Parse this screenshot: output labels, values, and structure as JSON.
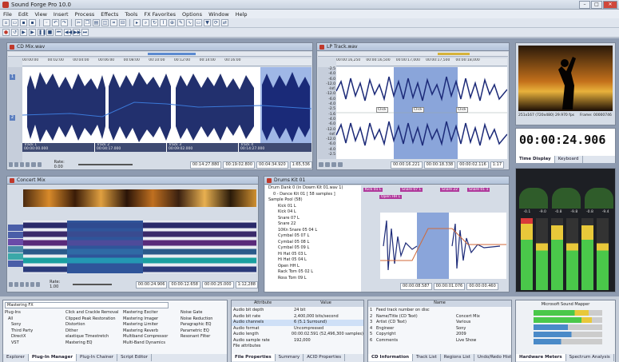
{
  "app": {
    "title": "Sound Forge Pro 10.0"
  },
  "menu": [
    "File",
    "Edit",
    "View",
    "Insert",
    "Process",
    "Effects",
    "Tools",
    "FX Favorites",
    "Options",
    "Window",
    "Help"
  ],
  "windows": {
    "cd_mix": {
      "title": "CD Mix.wav",
      "rate": "Rate: 0.00",
      "time1": "00:14:27.880",
      "time2": "00:19:02.800",
      "time3": "00:04:34.920",
      "zoom": "1:65,536",
      "tracks": [
        "Track 1",
        "Track 2",
        "Track 3",
        "Track 4"
      ],
      "track_times": [
        "00:00:00.000",
        "00:04:17.000",
        "00:09:02.000",
        "00:14:27.000"
      ]
    },
    "lp": {
      "title": "LP Track.wav",
      "time1": "00:00:16.221",
      "time2": "00:00:18.338",
      "time3": "00:00:02.116",
      "zoom": "1:17",
      "markers": [
        "Click",
        "Click",
        "Click"
      ],
      "db": [
        "-2.5",
        "-4.0",
        "-6.0",
        "-12.0",
        "-Inf.",
        "-12.0",
        "-6.0",
        "-4.0",
        "-2.5",
        "-1.6",
        "-4.0",
        "-6.0",
        "-12.0",
        "-Inf.",
        "-12.0",
        "-6.0",
        "-4.0",
        "-2.5"
      ]
    },
    "concert": {
      "title": "Concert Mix",
      "rate": "Rate: 1.00",
      "time1": "00:00:24.906",
      "time2": "00:00:12.658",
      "time3": "00:00:25.000",
      "zoom": "1:12,288"
    },
    "drums": {
      "title": "Drums Kit 01",
      "tree": [
        "Drum Dank 0 (in Dowm Kit 01.wav 1)",
        "0 - Dance Kit 01 [ 58 samples ]",
        "Sample Pool (58)",
        "Kick 01 L",
        "Kick 04 L",
        "Snare 07 L",
        "Snare 22",
        "10Kn Snare 05 04 L",
        "Cymbal 05 07 L",
        "Cymbal 05 08 L",
        "Cymbal 05 09 L",
        "Hi Hat 05 03 L",
        "Hi Hat 05 04 L",
        "Open HH L",
        "Rack Tom 05 02 L",
        "Ross Tom 09 L"
      ],
      "regions": [
        "Kick 01 L",
        "Snare 07 L",
        "Snare 22",
        "Open HH L",
        "Snare 01 1"
      ],
      "time1": "00:00:08.587",
      "time2": "00:00:01.076",
      "time3": "00:00:00.460"
    }
  },
  "video": {
    "info1": "251x167 (720x480) 29.970 fps",
    "info2": "Frame: 00000746"
  },
  "time_display": {
    "value": "00:00:24.906",
    "tab1": "Time Display",
    "tab2": "Keyboard"
  },
  "meters": {
    "labels": [
      "L",
      "R",
      "L",
      "R",
      "L",
      "R"
    ],
    "peaks": [
      "-0.1",
      "-9.0",
      "-0.8",
      "-9.8",
      "-0.8",
      "-9.4"
    ]
  },
  "plugin_manager": {
    "title": "Mastering FX",
    "tree": [
      "Plug-Ins",
      "All",
      "Sony",
      "Third Party",
      "DirectX",
      "VST"
    ],
    "col1": [
      "Click and Crackle Removal",
      "Clipped Peak Restoration",
      "Distortion",
      "Dither",
      "elastique Timestretch",
      "Mastering EQ"
    ],
    "col2": [
      "Mastering Exciter",
      "Mastering Imager",
      "Mastering Limiter",
      "Mastering Reverb",
      "Multiband Compressor",
      "Multi-Band Dynamics"
    ],
    "col3": [
      "Noise Gate",
      "Noise Reduction",
      "Paragraphic EQ",
      "Parametric EQ",
      "Resonant Filter"
    ],
    "tabs": [
      "Explorer",
      "Plug-In Manager",
      "Plug-In Chainer",
      "Script Editor"
    ]
  },
  "file_props": {
    "headers": [
      "Attribute",
      "Value"
    ],
    "rows": [
      [
        "Audio bit depth",
        "24 bit"
      ],
      [
        "Audio bit rate",
        "2,400,000 bits/second"
      ],
      [
        "Audio channels",
        "6 (5.1 Surround)"
      ],
      [
        "Audio format",
        "Uncompressed"
      ],
      [
        "Audio length",
        "00:00:02.591 (52,496,300 samples)"
      ],
      [
        "Audio sample rate",
        "192,000"
      ],
      [
        "File attributes",
        ""
      ]
    ],
    "tabs": [
      "File Properties",
      "Summary",
      "ACID Properties"
    ]
  },
  "cd_info": {
    "headers": [
      "Name",
      ""
    ],
    "rows": [
      [
        "1",
        "Feed track number on disc",
        ""
      ],
      [
        "2",
        "Name/Title (CD Text)",
        "Concert Mix"
      ],
      [
        "3",
        "Artist (CD Text)",
        "Various"
      ],
      [
        "4",
        "Engineer",
        "Sony"
      ],
      [
        "5",
        "Copyright",
        "2009"
      ],
      [
        "6",
        "Comments",
        "Live Show"
      ]
    ],
    "tabs": [
      "CD Information",
      "Track List",
      "Regions List",
      "Undo/Redo History"
    ]
  },
  "hw_meters": {
    "title": "Microsoft Sound Mapper",
    "tabs": [
      "Hardware Meters",
      "Spectrum Analysis"
    ]
  }
}
